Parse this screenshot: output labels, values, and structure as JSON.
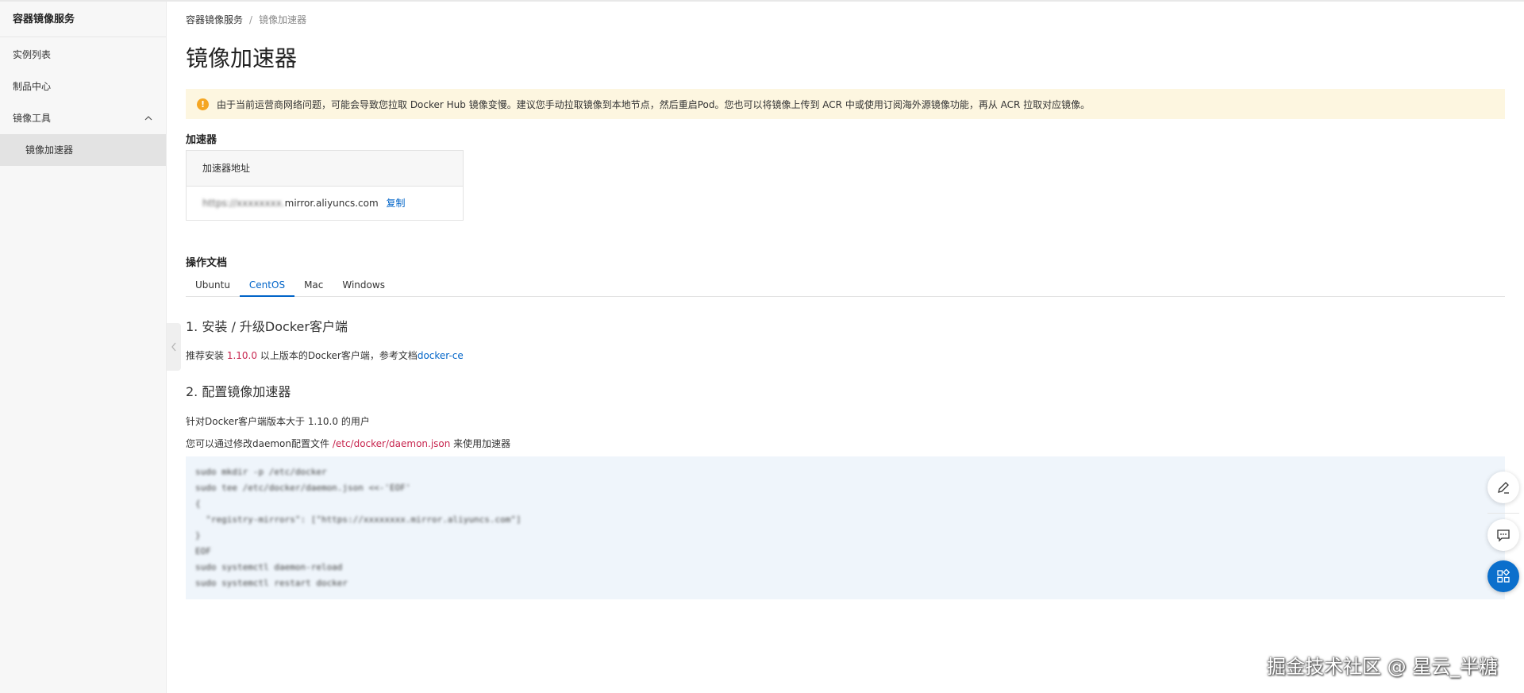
{
  "sidebar": {
    "title": "容器镜像服务",
    "items": [
      {
        "label": "实例列表"
      },
      {
        "label": "制品中心"
      },
      {
        "label": "镜像工具"
      },
      {
        "label": "镜像加速器"
      }
    ]
  },
  "breadcrumb": {
    "root": "容器镜像服务",
    "separator": "/",
    "current": "镜像加速器"
  },
  "page": {
    "title": "镜像加速器"
  },
  "notice": {
    "icon": "warning-icon",
    "text": "由于当前运营商网络问题，可能会导致您拉取 Docker Hub 镜像变慢。建议您手动拉取镜像到本地节点，然后重启Pod。您也可以将镜像上传到 ACR 中或使用订阅海外源镜像功能，再从 ACR 拉取对应镜像。"
  },
  "accelerator": {
    "section_title": "加速器",
    "column_header": "加速器地址",
    "address_prefix": "https://xxxxxxxx.",
    "address_domain": "mirror.aliyuncs.com",
    "copy_label": "复制"
  },
  "docs": {
    "section_title": "操作文档",
    "tabs": [
      {
        "label": "Ubuntu"
      },
      {
        "label": "CentOS"
      },
      {
        "label": "Mac"
      },
      {
        "label": "Windows"
      }
    ],
    "active_tab": "CentOS",
    "step1": {
      "heading": "1. 安装 / 升级Docker客户端",
      "text_before": "推荐安装 ",
      "version": "1.10.0",
      "text_middle": " 以上版本的Docker客户端，参考文档",
      "link": "docker-ce"
    },
    "step2": {
      "heading": "2. 配置镜像加速器",
      "line1": "针对Docker客户端版本大于 1.10.0 的用户",
      "line2_before": "您可以通过修改daemon配置文件 ",
      "line2_path": "/etc/docker/daemon.json",
      "line2_after": " 来使用加速器"
    },
    "code_lines": [
      "sudo mkdir -p /etc/docker",
      "sudo tee /etc/docker/daemon.json <<-'EOF'",
      "{",
      "  \"registry-mirrors\": [\"https://xxxxxxxx.mirror.aliyuncs.com\"]",
      "}",
      "EOF",
      "sudo systemctl daemon-reload",
      "sudo systemctl restart docker"
    ]
  },
  "floating": {
    "edit_icon": "edit-icon",
    "chat_icon": "chat-icon",
    "apps_icon": "apps-icon"
  },
  "watermark": "掘金技术社区 @ 星云_半糖"
}
